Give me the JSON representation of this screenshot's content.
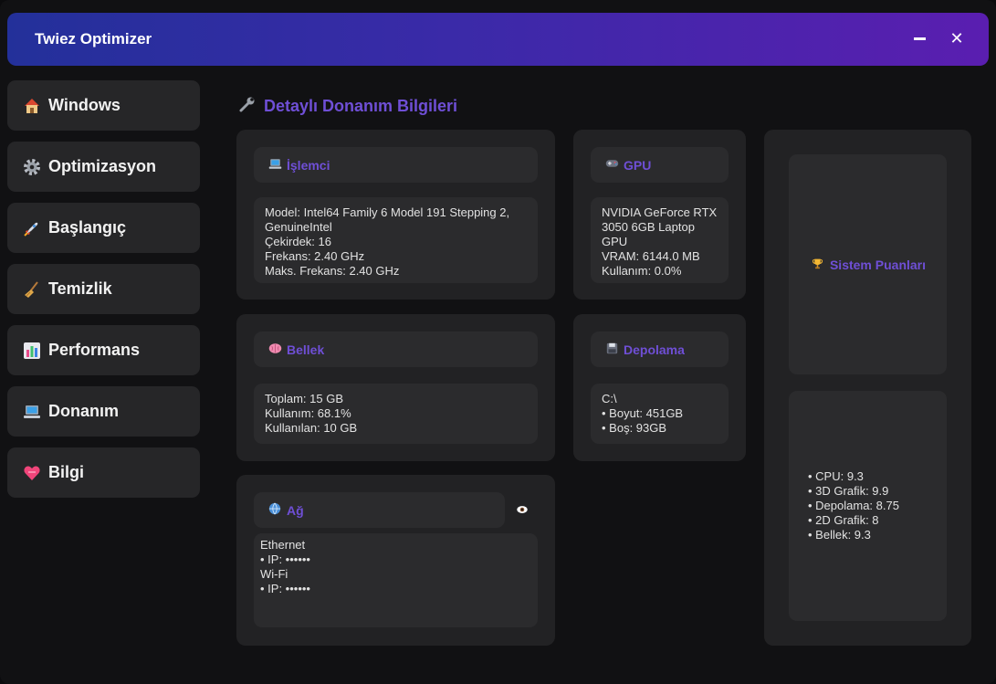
{
  "app": {
    "title": "Twiez Optimizer"
  },
  "window_controls": {
    "minimize": "",
    "close": "✕"
  },
  "sidebar": {
    "items": [
      {
        "label": "Windows",
        "icon": "house-icon"
      },
      {
        "label": "Optimizasyon",
        "icon": "gear-icon"
      },
      {
        "label": "Başlangıç",
        "icon": "rocket-icon"
      },
      {
        "label": "Temizlik",
        "icon": "broom-icon"
      },
      {
        "label": "Performans",
        "icon": "bar-chart-icon"
      },
      {
        "label": "Donanım",
        "icon": "laptop-icon"
      },
      {
        "label": "Bilgi",
        "icon": "heart-icon"
      }
    ]
  },
  "main": {
    "title": "Detaylı Donanım Bilgileri",
    "title_icon": "wrench-icon",
    "cpu": {
      "label": "İşlemci",
      "icon": "laptop-icon",
      "lines": [
        "Model: Intel64 Family 6 Model 191 Stepping 2,",
        "GenuineIntel",
        "Çekirdek: 16",
        "Frekans: 2.40 GHz",
        "Maks. Frekans: 2.40 GHz"
      ]
    },
    "gpu": {
      "label": "GPU",
      "icon": "gamepad-icon",
      "lines": [
        "NVIDIA GeForce RTX",
        "3050 6GB Laptop",
        "GPU",
        "VRAM: 6144.0 MB",
        "Kullanım: 0.0%"
      ]
    },
    "memory": {
      "label": "Bellek",
      "icon": "brain-icon",
      "lines": [
        "Toplam: 15 GB",
        "Kullanım: 68.1%",
        "Kullanılan: 10 GB"
      ]
    },
    "storage": {
      "label": "Depolama",
      "icon": "floppy-disk-icon",
      "lines": [
        "C:\\",
        "• Boyut: 451GB",
        "• Boş: 93GB"
      ]
    },
    "network": {
      "label": "Ağ",
      "icon": "globe-icon",
      "lines": [
        "Ethernet",
        "• IP: ••••••",
        "",
        "Wi-Fi",
        "• IP: ••••••"
      ]
    },
    "scores": {
      "label": "Sistem Puanları",
      "icon": "trophy-icon",
      "lines": [
        "• CPU: 9.3",
        "• 3D Grafik: 9.9",
        "• Depolama: 8.75",
        "• 2D Grafik: 8",
        "• Bellek: 9.3"
      ]
    }
  },
  "colors": {
    "accent": "#6f4fd6",
    "title_gradient_start": "#23309a",
    "title_gradient_end": "#5a1eb0",
    "card_bg": "#222224",
    "pill_bg": "#2b2b2d"
  }
}
